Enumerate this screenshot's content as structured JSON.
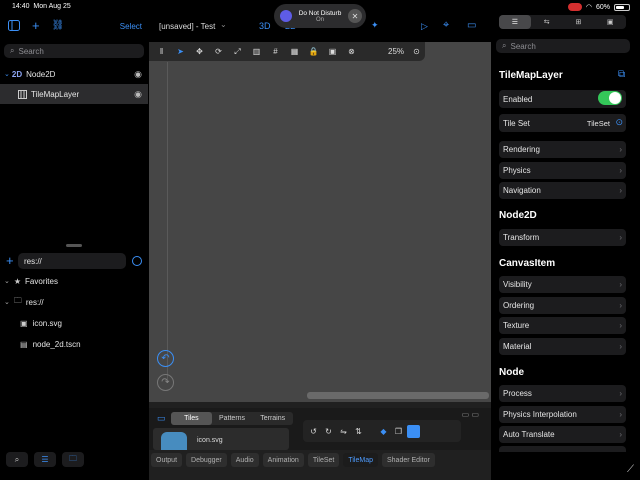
{
  "status": {
    "time": "14:40",
    "date": "Mon Aug 25",
    "battery": "60%"
  },
  "dnd": {
    "title": "Do Not Disturb",
    "state": "On"
  },
  "left": {
    "select_label": "Select",
    "search_placeholder": "Search",
    "tree": [
      {
        "label": "Node2D",
        "type_badge": "2D"
      },
      {
        "label": "TileMapLayer"
      }
    ],
    "fs_path": "res://",
    "files": [
      {
        "label": "Favorites"
      },
      {
        "label": "res://"
      },
      {
        "label": "icon.svg"
      },
      {
        "label": "node_2d.tscn"
      }
    ]
  },
  "center": {
    "scene_title": "[unsaved] - Test",
    "mode_3d": "3D",
    "mode_2d": "2D",
    "zoom": "25%",
    "tile_tabs": [
      "Tiles",
      "Patterns",
      "Terrains"
    ],
    "tile_item": "icon.svg",
    "bottom_tabs": [
      "Output",
      "Debugger",
      "Audio",
      "Animation",
      "TileSet",
      "TileMap",
      "Shader Editor"
    ],
    "active_tab": "TileMap"
  },
  "inspector": {
    "search_placeholder": "Search",
    "sections": {
      "tilemaplayer": "TileMapLayer",
      "node2d": "Node2D",
      "canvasitem": "CanvasItem",
      "node": "Node"
    },
    "enabled_label": "Enabled",
    "tileset_label": "Tile Set",
    "tileset_value": "TileSet",
    "rows_a": [
      "Rendering",
      "Physics",
      "Navigation"
    ],
    "rows_b": [
      "Transform"
    ],
    "rows_c": [
      "Visibility",
      "Ordering",
      "Texture",
      "Material"
    ],
    "rows_d": [
      "Process",
      "Physics Interpolation",
      "Auto Translate"
    ]
  },
  "colors": {
    "accent": "#3b8ff5",
    "toggle_on": "#34c759",
    "viewport": "#464646"
  }
}
